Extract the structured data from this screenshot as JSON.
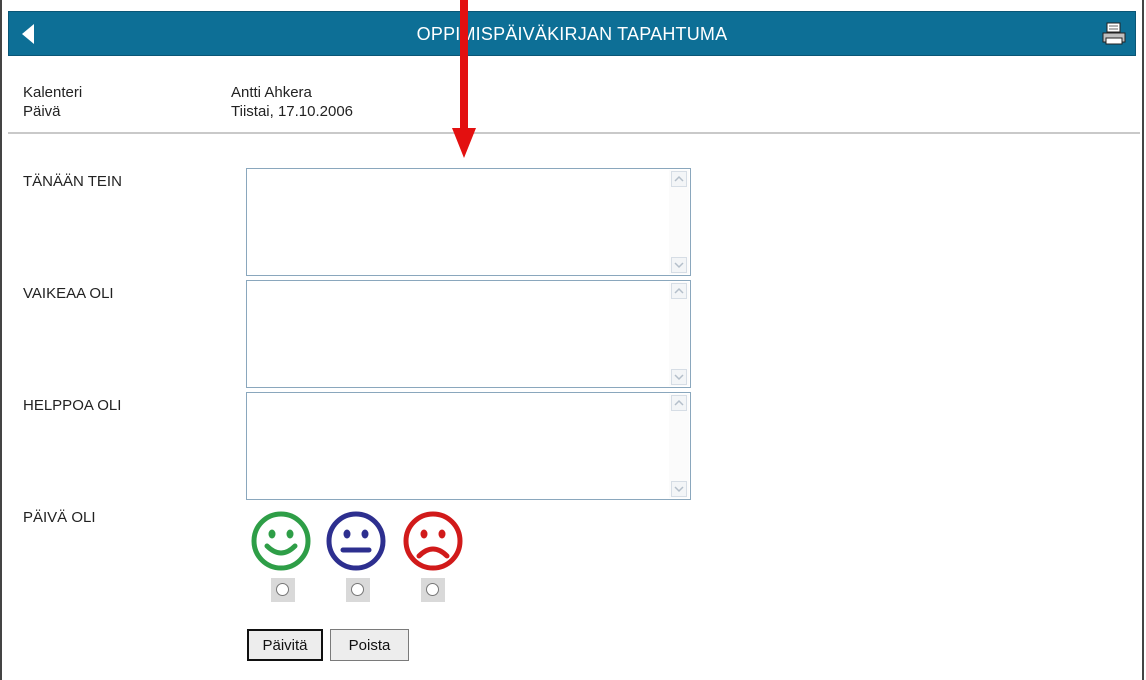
{
  "header": {
    "title": "OPPIMISPÄIVÄKIRJAN TAPAHTUMA",
    "accent": "#0d6f96"
  },
  "meta": {
    "calendar_label": "Kalenteri",
    "calendar_value": "Antti Ahkera",
    "day_label": "Päivä",
    "day_value": "Tiistai, 17.10.2006"
  },
  "fields": [
    {
      "label": "TÄNÄÄN TEIN",
      "value": ""
    },
    {
      "label": "VAIKEAA OLI",
      "value": ""
    },
    {
      "label": "HELPPOA OLI",
      "value": ""
    }
  ],
  "mood": {
    "label": "PÄIVÄ OLI",
    "options": [
      {
        "icon": "happy-face-icon",
        "color": "#2e9e47",
        "selected": false
      },
      {
        "icon": "neutral-face-icon",
        "color": "#2d2f8f",
        "selected": false
      },
      {
        "icon": "sad-face-icon",
        "color": "#d11a1a",
        "selected": false
      }
    ]
  },
  "buttons": {
    "update_label": "Päivitä",
    "delete_label": "Poista"
  },
  "annotation": {
    "icon": "red-arrow-icon",
    "color": "#e31010"
  }
}
